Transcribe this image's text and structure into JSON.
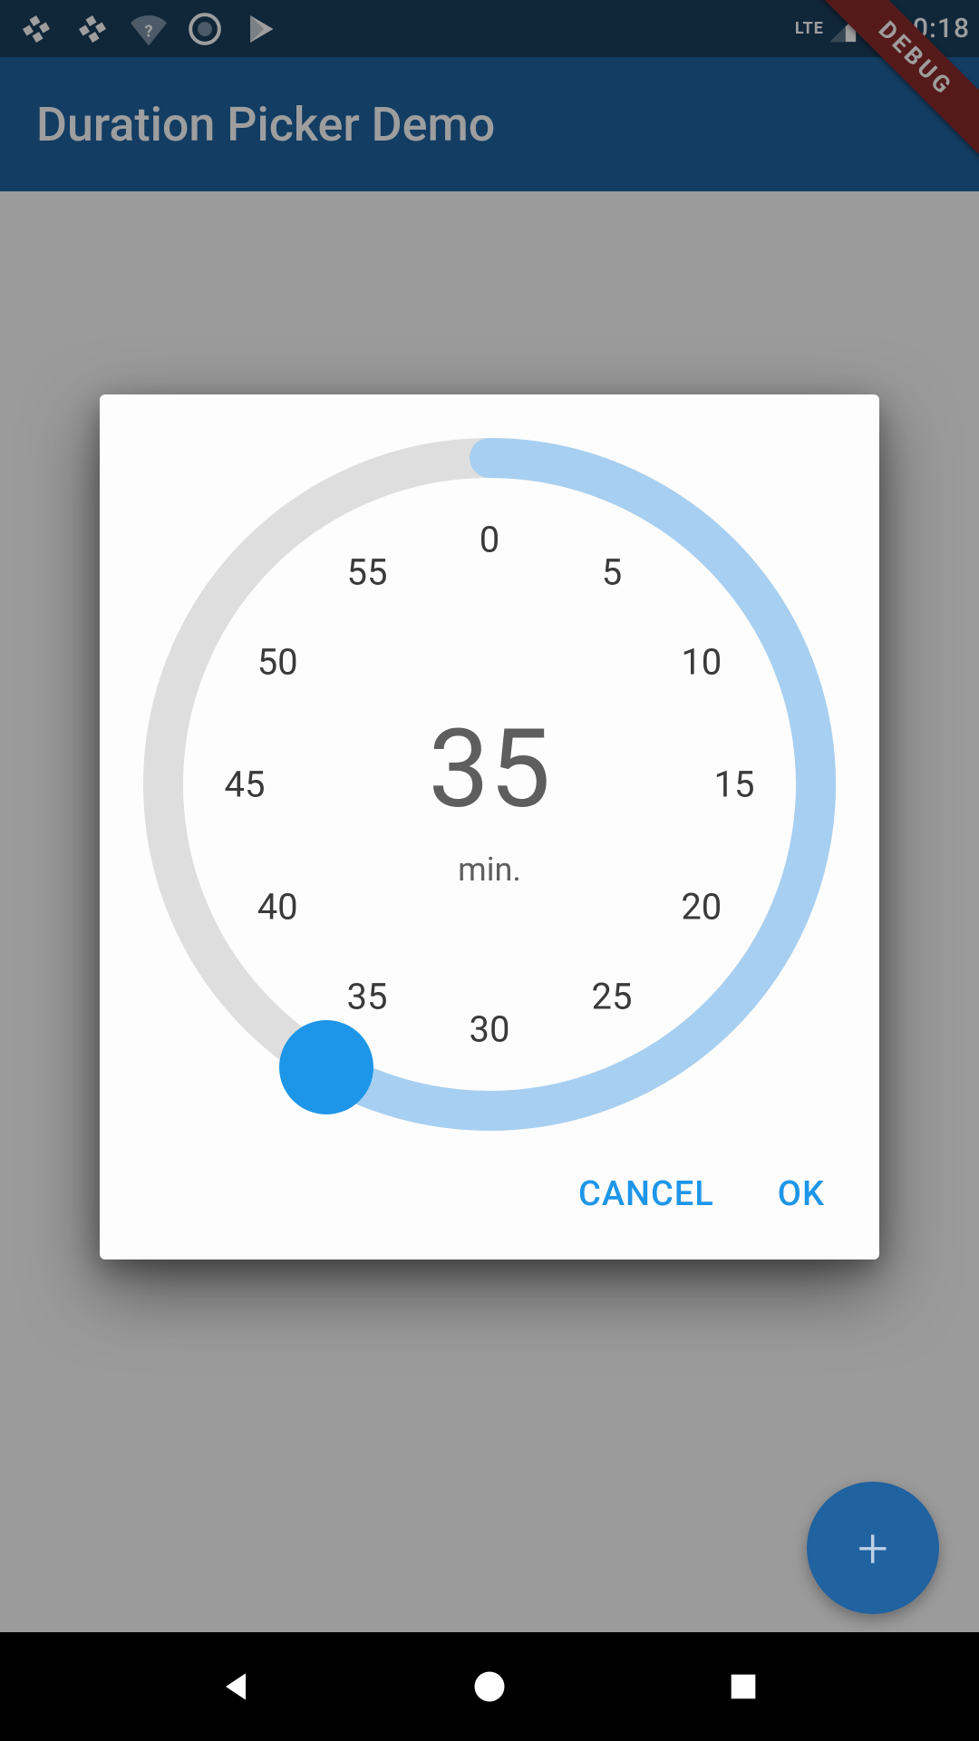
{
  "status": {
    "time": "10:18",
    "lte": "LTE"
  },
  "app": {
    "title": "Duration Picker Demo"
  },
  "debug": {
    "label": "DEBUG"
  },
  "fab": {
    "glyph": "+"
  },
  "picker": {
    "value": "35",
    "unit": "min.",
    "ticks": [
      "0",
      "5",
      "10",
      "15",
      "20",
      "25",
      "30",
      "35",
      "40",
      "45",
      "50",
      "55"
    ],
    "selected_index": 7,
    "track_color": "#dedede",
    "fill_color": "#a7cff1",
    "handle_color": "#1e96e8"
  },
  "dialog": {
    "cancel": "CANCEL",
    "ok": "OK"
  }
}
